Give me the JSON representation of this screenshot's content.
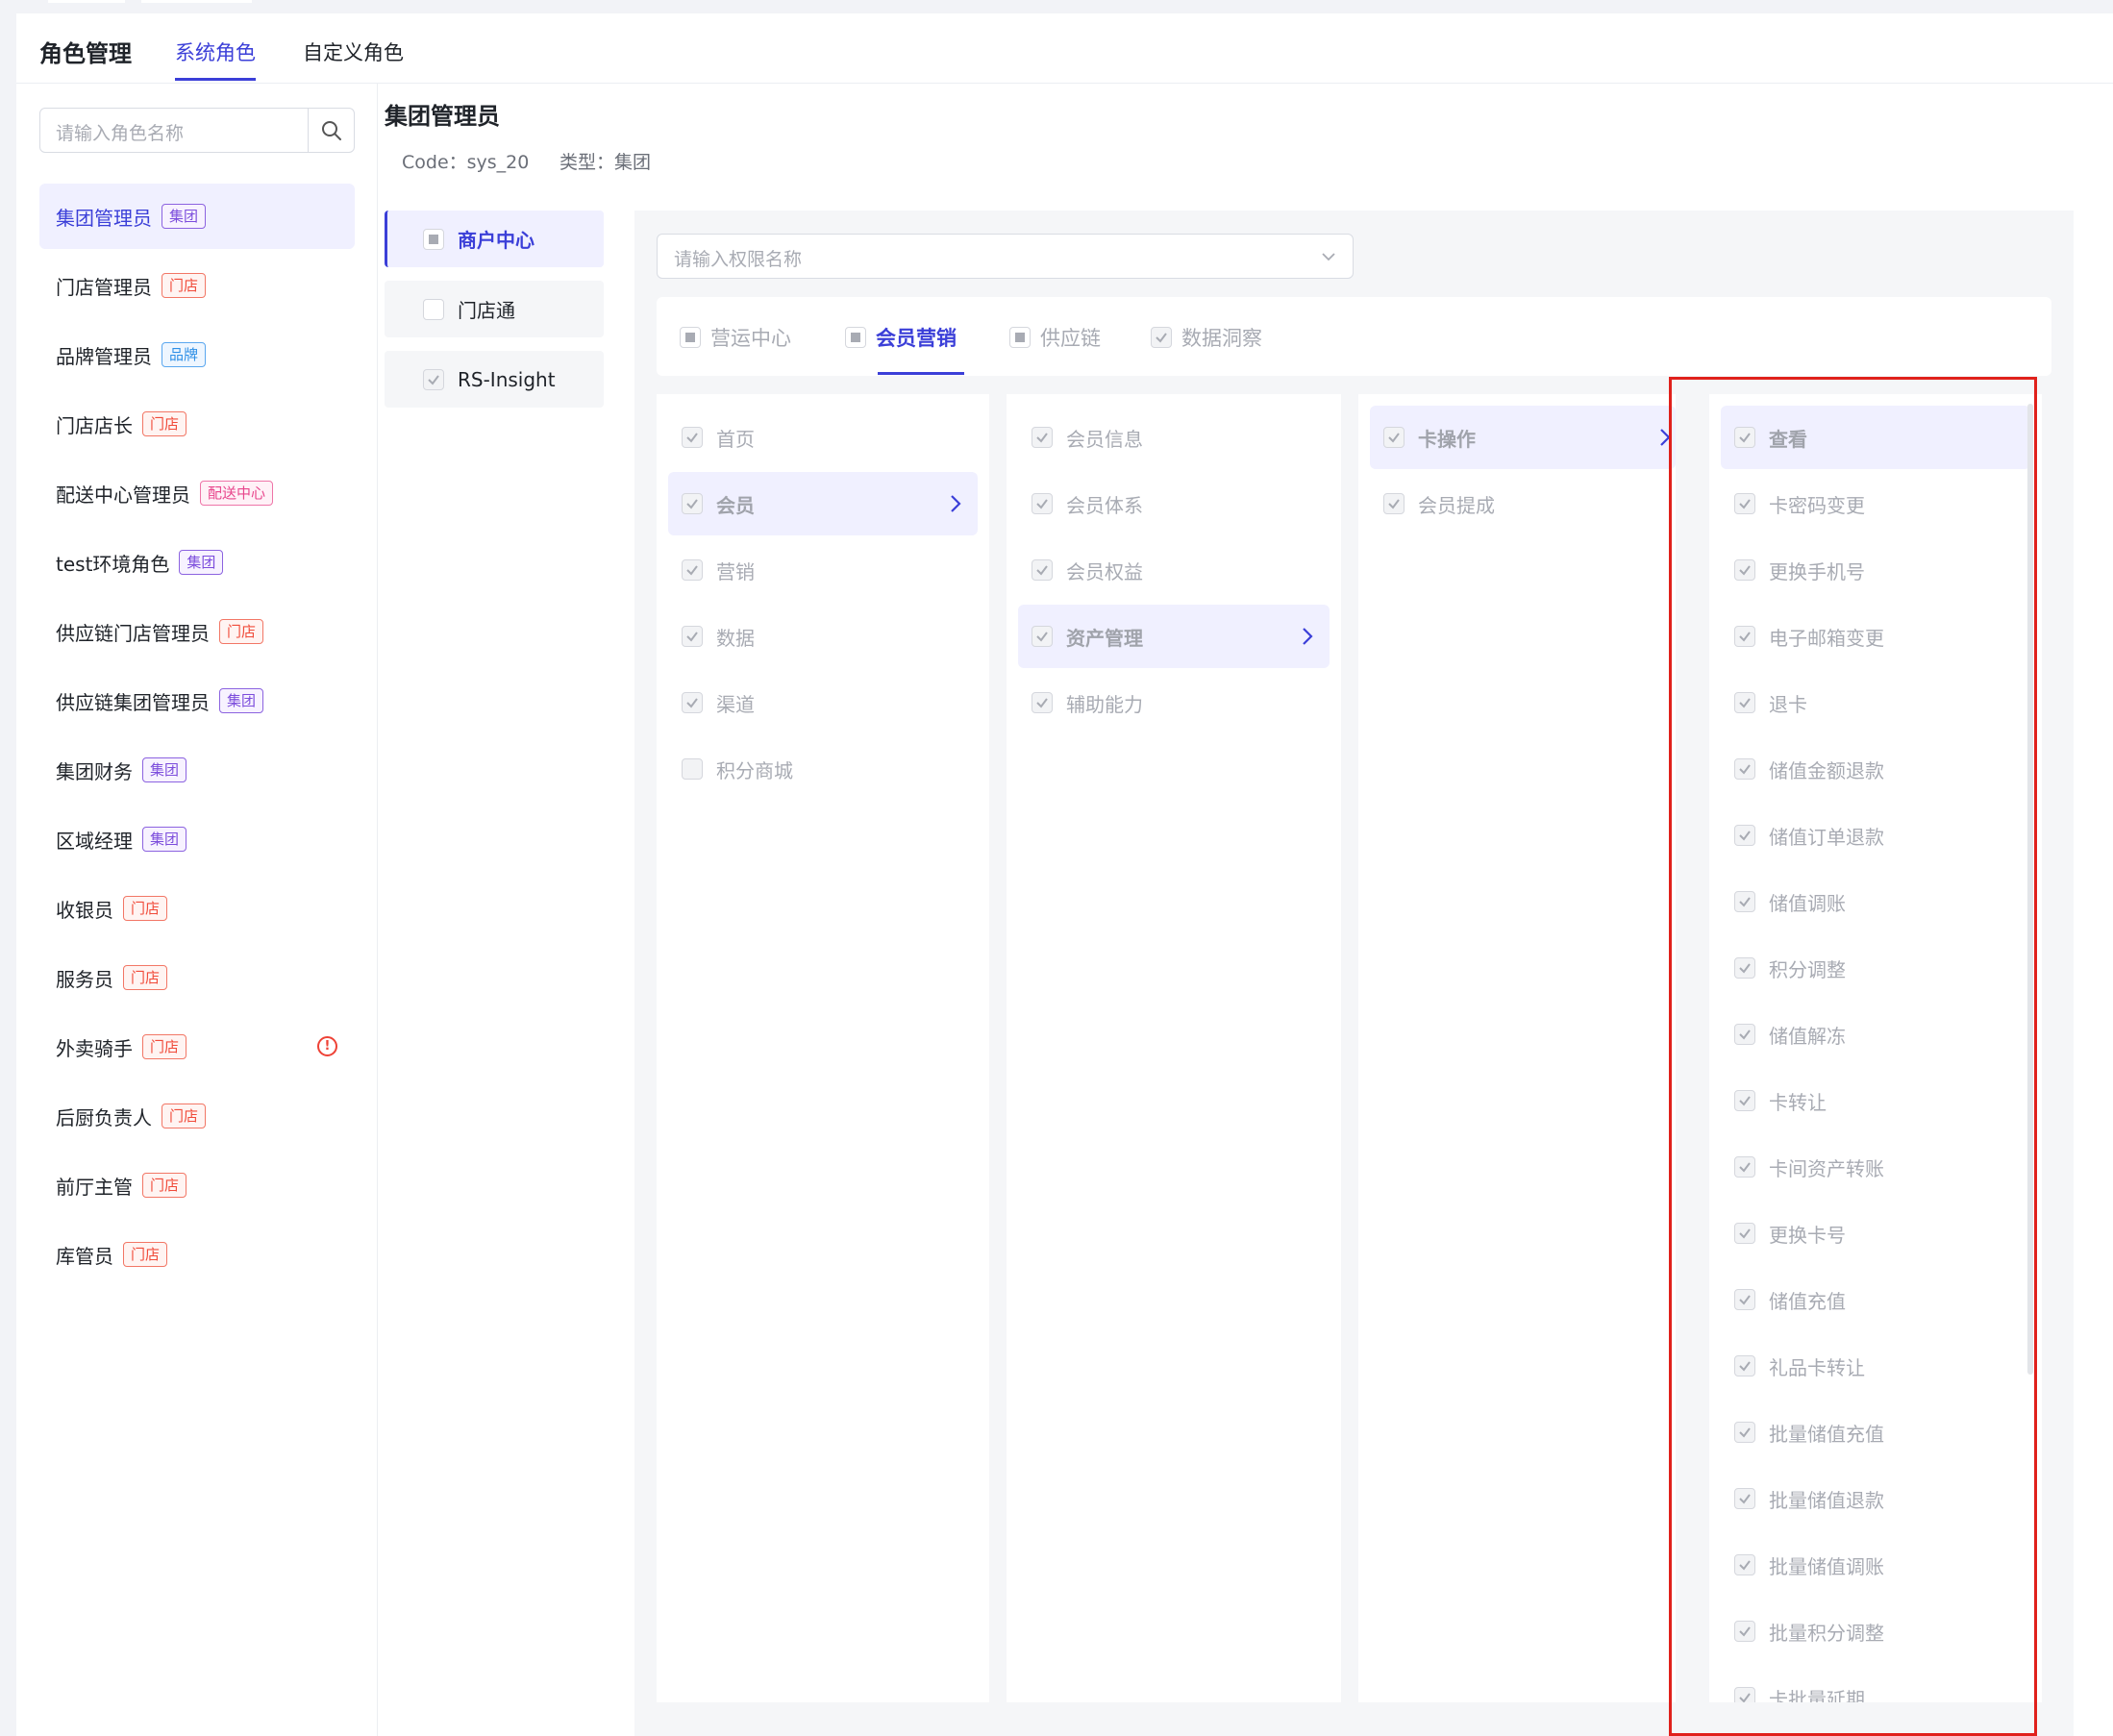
{
  "header": {
    "title": "角色管理",
    "tabs": [
      "系统角色",
      "自定义角色"
    ]
  },
  "sidebar": {
    "search_placeholder": "请输入角色名称",
    "roles": [
      {
        "name": "集团管理员",
        "tag": "集团"
      },
      {
        "name": "门店管理员",
        "tag": "门店"
      },
      {
        "name": "品牌管理员",
        "tag": "品牌"
      },
      {
        "name": "门店店长",
        "tag": "门店"
      },
      {
        "name": "配送中心管理员",
        "tag": "配送中心"
      },
      {
        "name": "test环境角色",
        "tag": "集团"
      },
      {
        "name": "供应链门店管理员",
        "tag": "门店"
      },
      {
        "name": "供应链集团管理员",
        "tag": "集团"
      },
      {
        "name": "集团财务",
        "tag": "集团"
      },
      {
        "name": "区域经理",
        "tag": "集团"
      },
      {
        "name": "收银员",
        "tag": "门店"
      },
      {
        "name": "服务员",
        "tag": "门店"
      },
      {
        "name": "外卖骑手",
        "tag": "门店"
      },
      {
        "name": "后厨负责人",
        "tag": "门店"
      },
      {
        "name": "前厅主管",
        "tag": "门店"
      },
      {
        "name": "库管员",
        "tag": "门店"
      }
    ],
    "warn_symbol": "!"
  },
  "main": {
    "title": "集团管理员",
    "code": "Code：sys_20",
    "type": "类型：集团",
    "systems": [
      "商户中心",
      "门店通",
      "RS-Insight"
    ],
    "perm_search_placeholder": "请输入权限名称",
    "modules": [
      "营运中心",
      "会员营销",
      "供应链",
      "数据洞察"
    ],
    "col1": [
      "首页",
      "会员",
      "营销",
      "数据",
      "渠道",
      "积分商城"
    ],
    "col2": [
      "会员信息",
      "会员体系",
      "会员权益",
      "资产管理",
      "辅助能力"
    ],
    "col3": [
      "卡操作",
      "会员提成"
    ],
    "col4": [
      "查看",
      "卡密码变更",
      "更换手机号",
      "电子邮箱变更",
      "退卡",
      "储值金额退款",
      "储值订单退款",
      "储值调账",
      "积分调整",
      "储值解冻",
      "卡转让",
      "卡间资产转账",
      "更换卡号",
      "储值充值",
      "礼品卡转让",
      "批量储值充值",
      "批量储值退款",
      "批量储值调账",
      "批量积分调整",
      "卡批量延期"
    ]
  },
  "colors": {
    "accent": "#3b3fd8",
    "tag_group": "#7c4ddc",
    "tag_store": "#f04b3a",
    "tag_brand": "#2e8fe6",
    "tag_distribution": "#e8468c",
    "highlight_box": "#e0211c"
  }
}
